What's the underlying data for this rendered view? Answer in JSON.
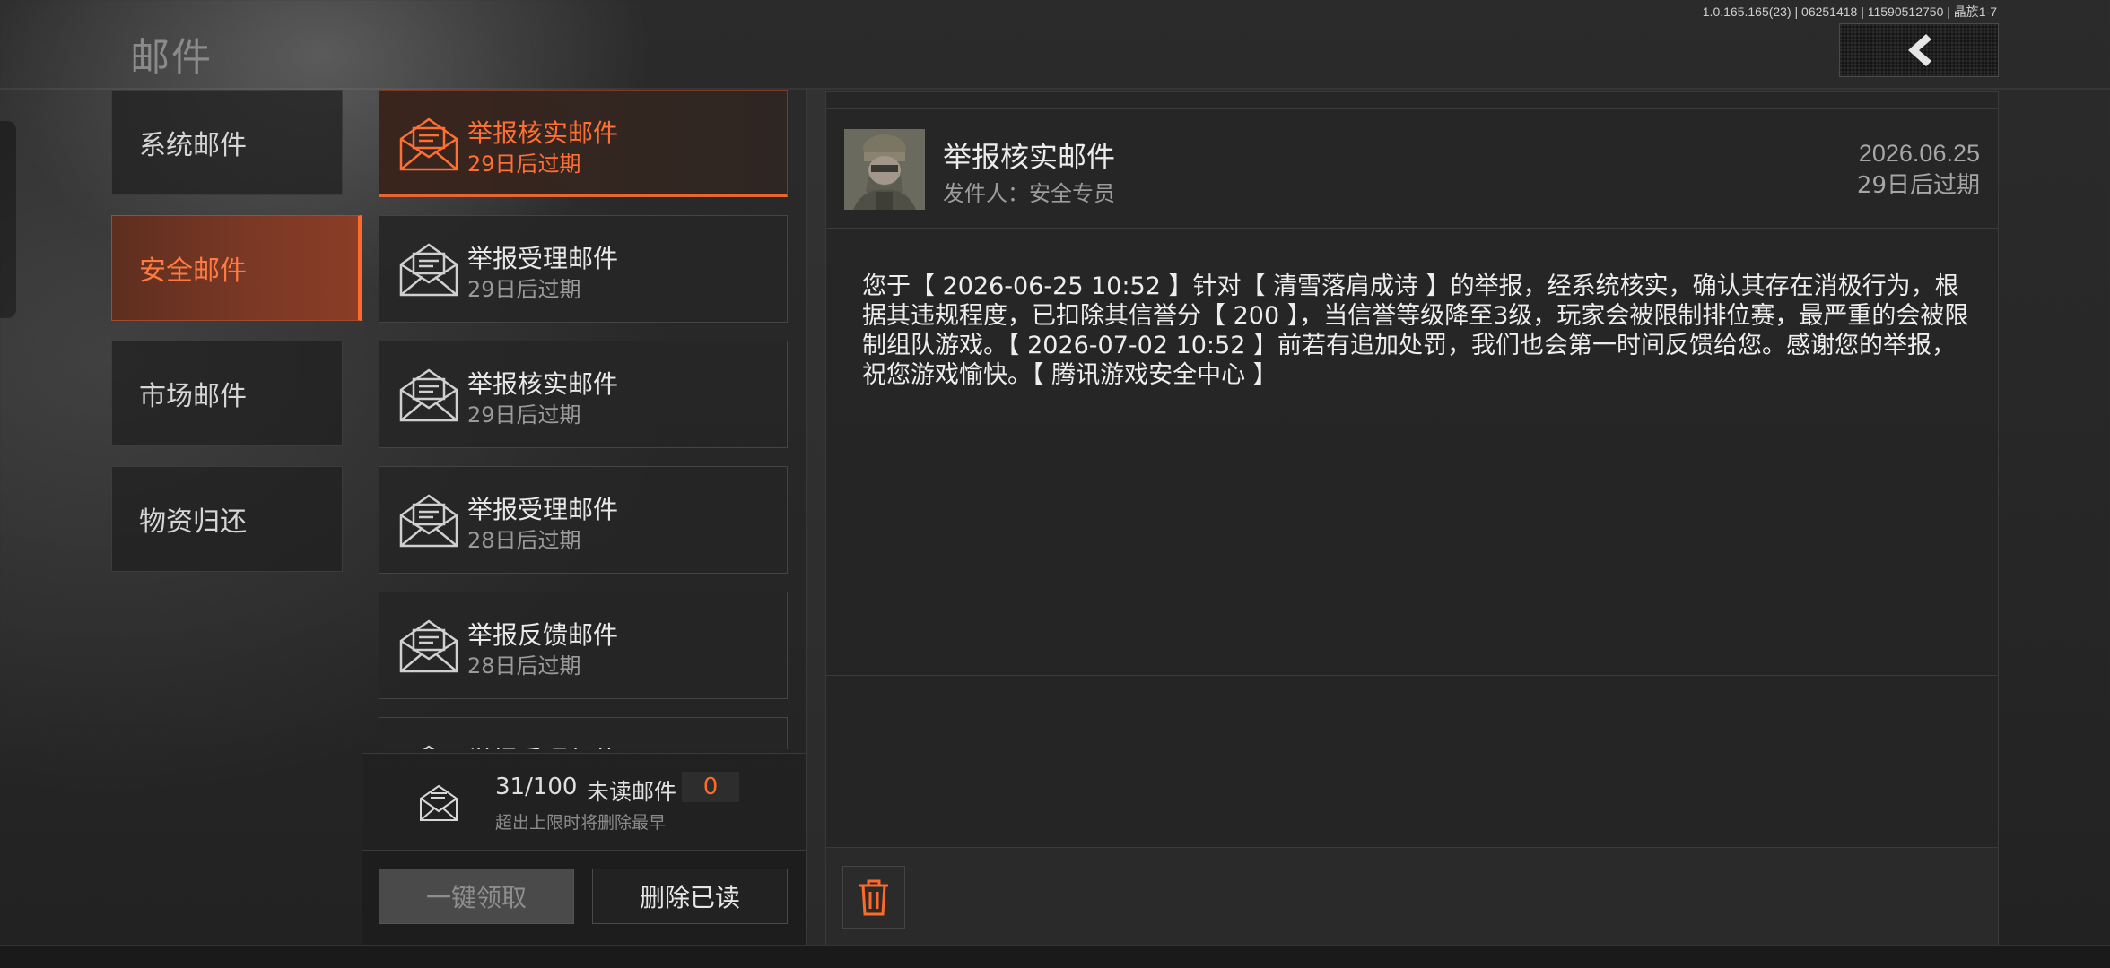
{
  "header": {
    "title": "邮件",
    "version_info": "1.0.165.165(23) | 06251418 | 11590512750 | 晶族1-7",
    "back_icon": "chevron-left-icon"
  },
  "categories": [
    {
      "label": "系统邮件",
      "active": false
    },
    {
      "label": "安全邮件",
      "active": true
    },
    {
      "label": "市场邮件",
      "active": false
    },
    {
      "label": "物资归还",
      "active": false
    }
  ],
  "mail_list": [
    {
      "subject": "举报核实邮件",
      "expiry": "29日后过期",
      "selected": true
    },
    {
      "subject": "举报受理邮件",
      "expiry": "29日后过期",
      "selected": false
    },
    {
      "subject": "举报核实邮件",
      "expiry": "29日后过期",
      "selected": false
    },
    {
      "subject": "举报受理邮件",
      "expiry": "28日后过期",
      "selected": false
    },
    {
      "subject": "举报反馈邮件",
      "expiry": "28日后过期",
      "selected": false
    },
    {
      "subject": "举报受理邮件",
      "expiry": "",
      "selected": false
    }
  ],
  "list_footer": {
    "mail_count": "31/100",
    "unread_label": "未读邮件",
    "unread_count": "0",
    "limit_note": "超出上限时将删除最早",
    "claim_all_label": "一键领取",
    "delete_read_label": "删除已读"
  },
  "detail": {
    "subject": "举报核实邮件",
    "sender": "发件人：安全专员",
    "date": "2026.06.25",
    "expiry": "29日后过期",
    "body": "您于【 2026-06-25 10:52 】针对【 清雪落肩成诗 】的举报，经系统核实，确认其存在消极行为，根据其违规程度，已扣除其信誉分【 200 】，当信誉等级降至3级，玩家会被限制排位赛，最严重的会被限制组队游戏。【 2026-07-02 10:52 】前若有追加处罚，我们也会第一时间反馈给您。感谢您的举报，祝您游戏愉快。【 腾讯游戏安全中心 】",
    "trash_icon": "trash-icon"
  },
  "colors": {
    "accent": "#ff6a2a",
    "active_bg": "#7a3825",
    "panel_bg": "#262626"
  }
}
